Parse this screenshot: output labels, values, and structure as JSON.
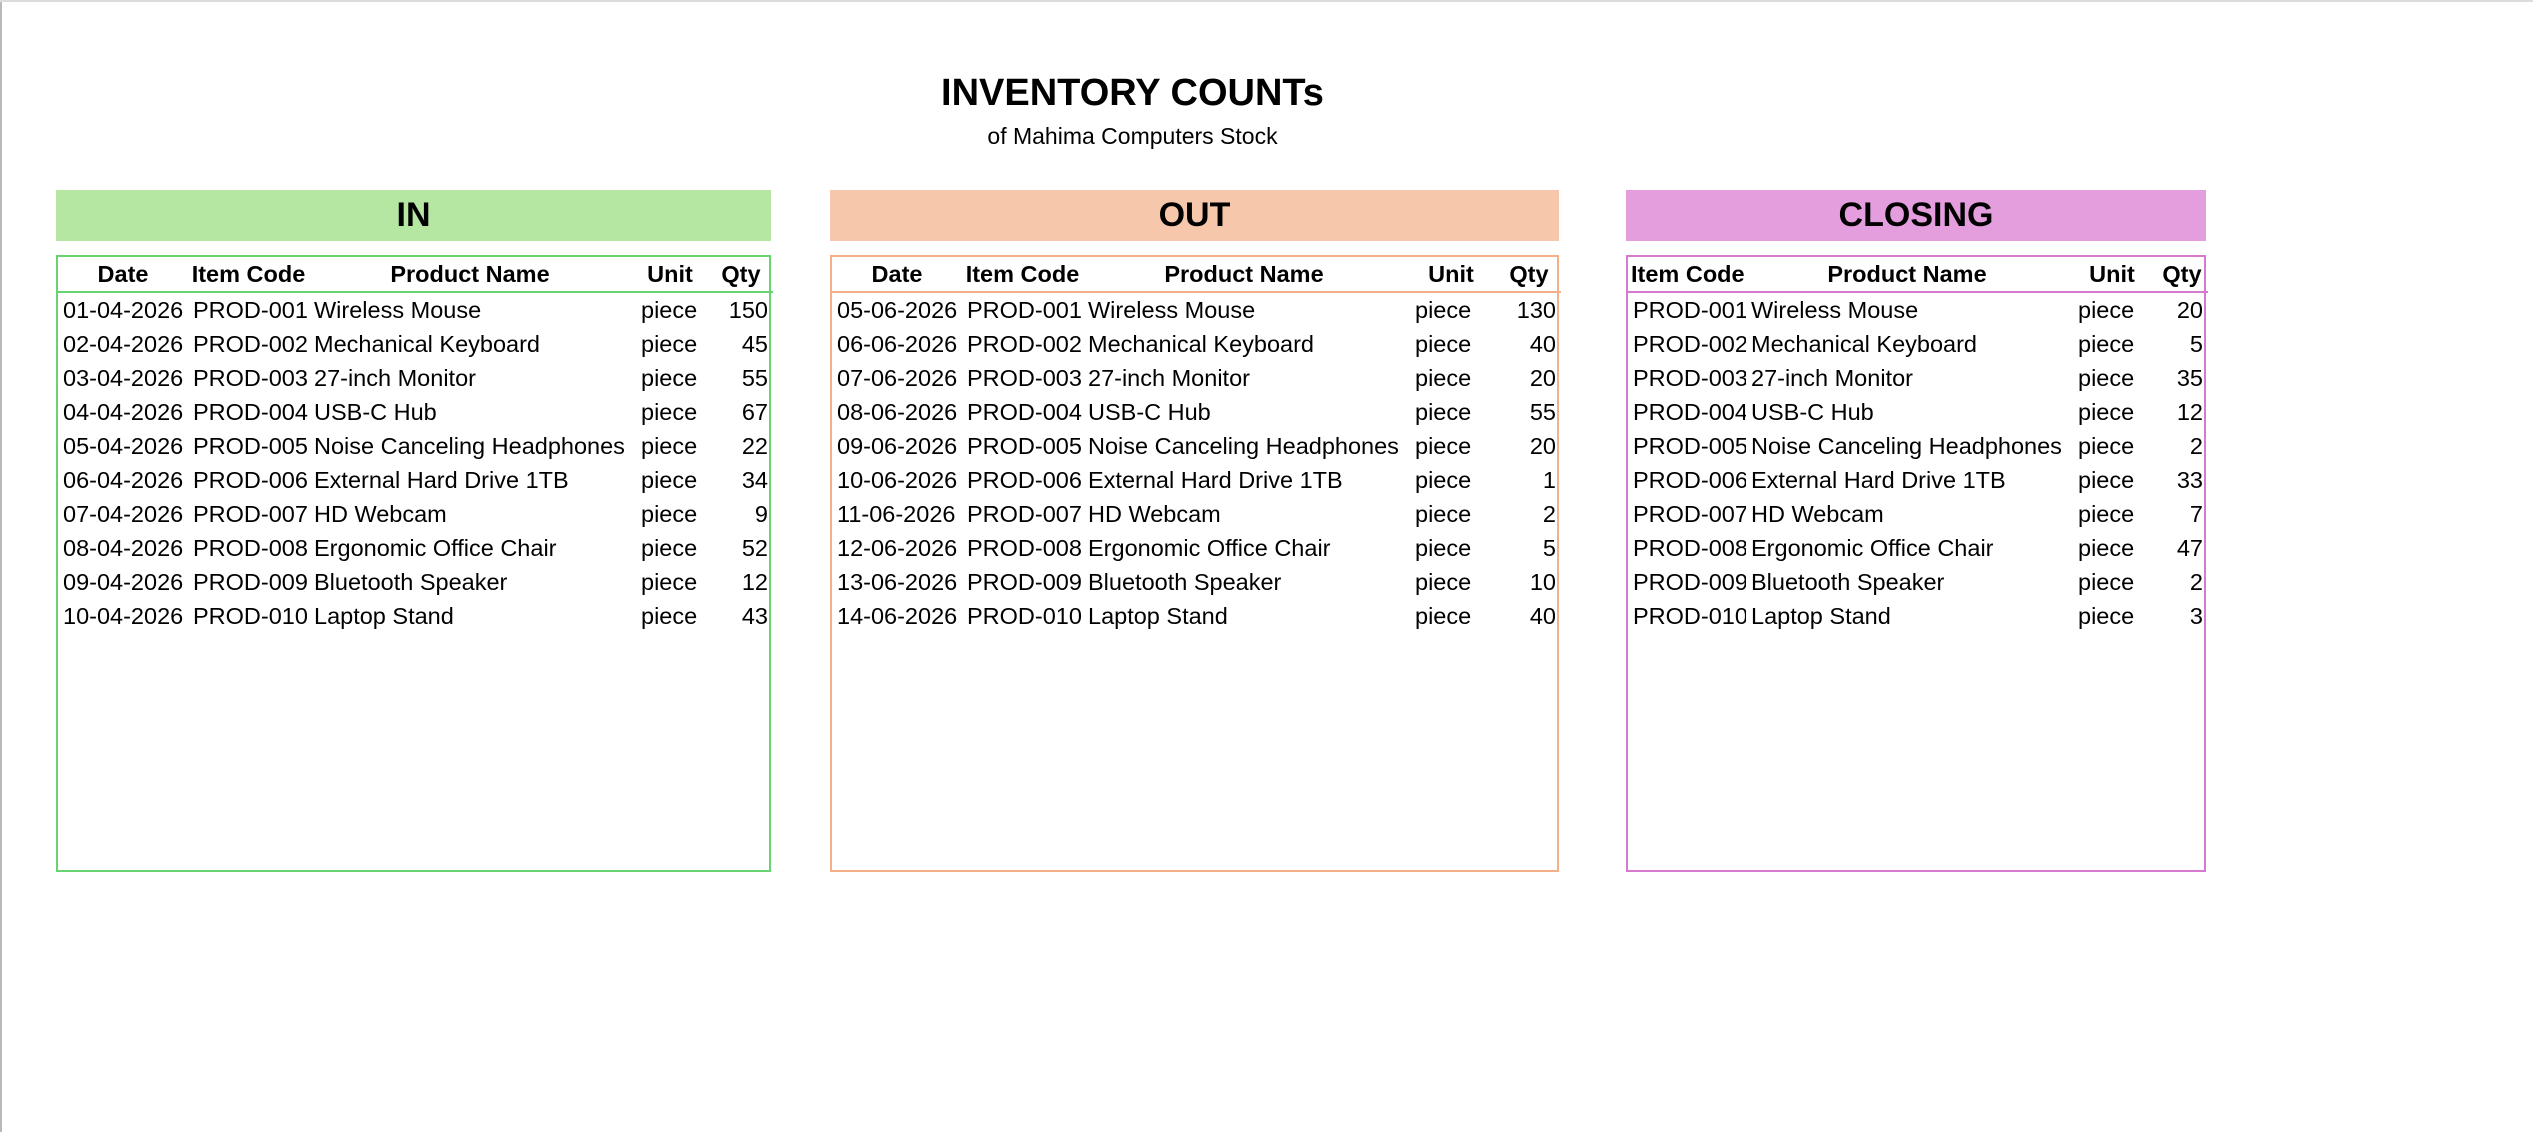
{
  "title": "INVENTORY COUNTs",
  "subtitle": "of Mahima Computers Stock",
  "colors": {
    "in_fill": "#b5e6a2",
    "in_line": "#69d36f",
    "out_fill": "#f7c7ac",
    "out_line": "#f5b08a",
    "closing_fill": "#e59edd",
    "closing_line": "#d67ad0"
  },
  "in": {
    "heading": "IN",
    "columns": [
      "Date",
      "Item Code",
      "Product Name",
      "Unit",
      "Qty"
    ],
    "rows": [
      [
        "01-04-2026",
        "PROD-001",
        "Wireless Mouse",
        "piece",
        "150"
      ],
      [
        "02-04-2026",
        "PROD-002",
        "Mechanical Keyboard",
        "piece",
        "45"
      ],
      [
        "03-04-2026",
        "PROD-003",
        "27-inch Monitor",
        "piece",
        "55"
      ],
      [
        "04-04-2026",
        "PROD-004",
        "USB-C Hub",
        "piece",
        "67"
      ],
      [
        "05-04-2026",
        "PROD-005",
        "Noise Canceling Headphones",
        "piece",
        "22"
      ],
      [
        "06-04-2026",
        "PROD-006",
        "External Hard Drive 1TB",
        "piece",
        "34"
      ],
      [
        "07-04-2026",
        "PROD-007",
        "HD Webcam",
        "piece",
        "9"
      ],
      [
        "08-04-2026",
        "PROD-008",
        "Ergonomic Office Chair",
        "piece",
        "52"
      ],
      [
        "09-04-2026",
        "PROD-009",
        "Bluetooth Speaker",
        "piece",
        "12"
      ],
      [
        "10-04-2026",
        "PROD-010",
        "Laptop Stand",
        "piece",
        "43"
      ]
    ]
  },
  "out": {
    "heading": "OUT",
    "columns": [
      "Date",
      "Item Code",
      "Product Name",
      "Unit",
      "Qty"
    ],
    "rows": [
      [
        "05-06-2026",
        "PROD-001",
        "Wireless Mouse",
        "piece",
        "130"
      ],
      [
        "06-06-2026",
        "PROD-002",
        "Mechanical Keyboard",
        "piece",
        "40"
      ],
      [
        "07-06-2026",
        "PROD-003",
        "27-inch Monitor",
        "piece",
        "20"
      ],
      [
        "08-06-2026",
        "PROD-004",
        "USB-C Hub",
        "piece",
        "55"
      ],
      [
        "09-06-2026",
        "PROD-005",
        "Noise Canceling Headphones",
        "piece",
        "20"
      ],
      [
        "10-06-2026",
        "PROD-006",
        "External Hard Drive 1TB",
        "piece",
        "1"
      ],
      [
        "11-06-2026",
        "PROD-007",
        "HD Webcam",
        "piece",
        "2"
      ],
      [
        "12-06-2026",
        "PROD-008",
        "Ergonomic Office Chair",
        "piece",
        "5"
      ],
      [
        "13-06-2026",
        "PROD-009",
        "Bluetooth Speaker",
        "piece",
        "10"
      ],
      [
        "14-06-2026",
        "PROD-010",
        "Laptop Stand",
        "piece",
        "40"
      ]
    ]
  },
  "closing": {
    "heading": "CLOSING",
    "columns": [
      "Item Code",
      "Product Name",
      "Unit",
      "Qty"
    ],
    "rows": [
      [
        "PROD-001",
        "Wireless Mouse",
        "piece",
        "20"
      ],
      [
        "PROD-002",
        "Mechanical Keyboard",
        "piece",
        "5"
      ],
      [
        "PROD-003",
        "27-inch Monitor",
        "piece",
        "35"
      ],
      [
        "PROD-004",
        "USB-C Hub",
        "piece",
        "12"
      ],
      [
        "PROD-005",
        "Noise Canceling Headphones",
        "piece",
        "2"
      ],
      [
        "PROD-006",
        "External Hard Drive 1TB",
        "piece",
        "33"
      ],
      [
        "PROD-007",
        "HD Webcam",
        "piece",
        "7"
      ],
      [
        "PROD-008",
        "Ergonomic Office Chair",
        "piece",
        "47"
      ],
      [
        "PROD-009",
        "Bluetooth Speaker",
        "piece",
        "2"
      ],
      [
        "PROD-010",
        "Laptop Stand",
        "piece",
        "3"
      ]
    ]
  }
}
